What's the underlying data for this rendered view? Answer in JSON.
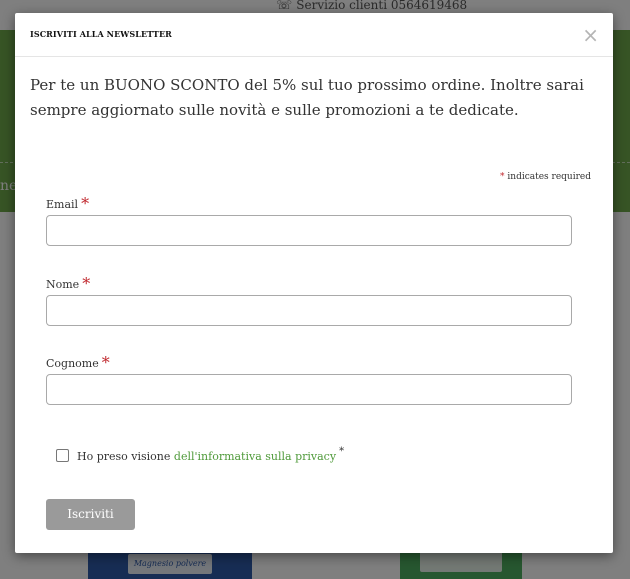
{
  "background": {
    "topbar": {
      "phone_icon": "headset-icon",
      "phone_text": "Servizio clienti 0564619468"
    },
    "menu_partial_text": "ne",
    "product_left_label": "Magnesio polvere",
    "colors": {
      "brand_green": "#6fa84b",
      "link_green": "#4f9a3a",
      "required_red": "#c0272d"
    }
  },
  "modal": {
    "title": "ISCRIVITI ALLA NEWSLETTER",
    "close_label": "×",
    "intro": "Per te un BUONO SCONTO del 5% sul tuo prossimo ordine. Inoltre sarai sempre aggiornato sulle novità e sulle promozioni a te dedicate.",
    "form": {
      "required_marker": "*",
      "required_note": "indicates required",
      "fields": [
        {
          "label": "Email",
          "value": "",
          "placeholder": ""
        },
        {
          "label": "Nome",
          "value": "",
          "placeholder": ""
        },
        {
          "label": "Cognome",
          "value": "",
          "placeholder": ""
        }
      ],
      "privacy": {
        "checked": false,
        "text": "Ho preso visione",
        "link_text": "dell'informativa sulla privacy",
        "marker": "*"
      },
      "submit_label": "Iscriviti"
    }
  }
}
